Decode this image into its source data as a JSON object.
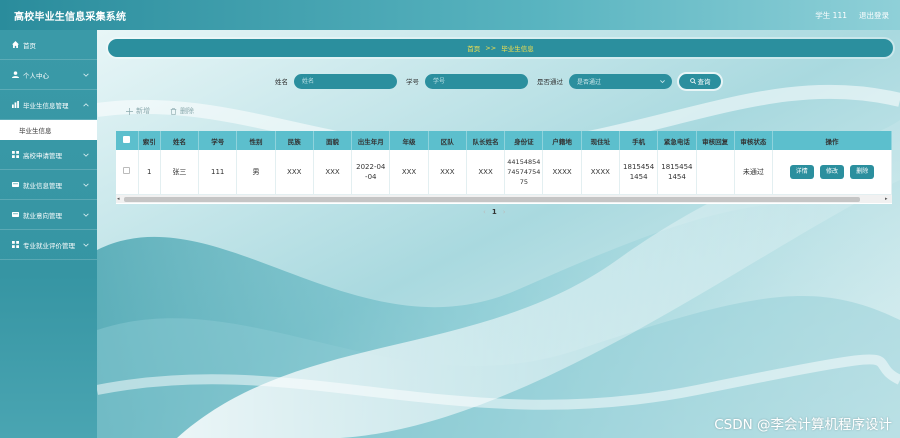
{
  "app": {
    "title": "高校毕业生信息采集系统"
  },
  "topbar": {
    "user": "学生 111",
    "logout": "退出登录"
  },
  "sidebar": {
    "items": [
      {
        "label": "首页",
        "icon": "home-icon"
      },
      {
        "label": "个人中心",
        "icon": "user-icon"
      },
      {
        "label": "毕业生信息管理",
        "icon": "chart-icon"
      },
      {
        "label": "高校申请管理",
        "icon": "grid-icon"
      },
      {
        "label": "就业信息管理",
        "icon": "card-icon"
      },
      {
        "label": "就业意向管理",
        "icon": "card-icon"
      },
      {
        "label": "专业就业评价管理",
        "icon": "grid-icon"
      }
    ],
    "active_sub": "毕业生信息"
  },
  "breadcrumb": {
    "home": "首页",
    "sep": ">>",
    "current": "毕业生信息"
  },
  "search": {
    "name_label": "姓名",
    "name_placeholder": "姓名",
    "id_label": "学号",
    "id_placeholder": "学号",
    "pass_label": "是否通过",
    "pass_value": "是否通过",
    "button": "查询"
  },
  "actions": {
    "add": "新增",
    "delete": "删除"
  },
  "table": {
    "headers": [
      "索引",
      "姓名",
      "学号",
      "性别",
      "民族",
      "面貌",
      "出生年月",
      "年级",
      "区队",
      "队长姓名",
      "身份证",
      "户籍地",
      "现住址",
      "手机",
      "紧急电话",
      "审核回复",
      "审核状态",
      "操作"
    ],
    "rows": [
      {
        "index": "1",
        "name": "张三",
        "student_id": "111",
        "gender": "男",
        "ethnicity": "XXX",
        "politics": "XXX",
        "birth": "2022-04-04",
        "grade": "XXX",
        "squad": "XXX",
        "leader": "XXX",
        "id_card": "441548547457475475",
        "hometown": "XXXX",
        "address": "XXXX",
        "phone": "18154541454",
        "emergency": "18154541454",
        "reply": "",
        "status": "未通过"
      }
    ],
    "ops": {
      "detail": "详情",
      "edit": "修改",
      "delete": "删除"
    }
  },
  "pager": {
    "prev": "‹",
    "page": "1",
    "next": "›"
  },
  "watermark": "CSDN @李会计算机程序设计",
  "colors": {
    "accent": "#2b8f9e",
    "header": "#5cbfcd",
    "breadcrumb_text": "#f4e04d"
  }
}
